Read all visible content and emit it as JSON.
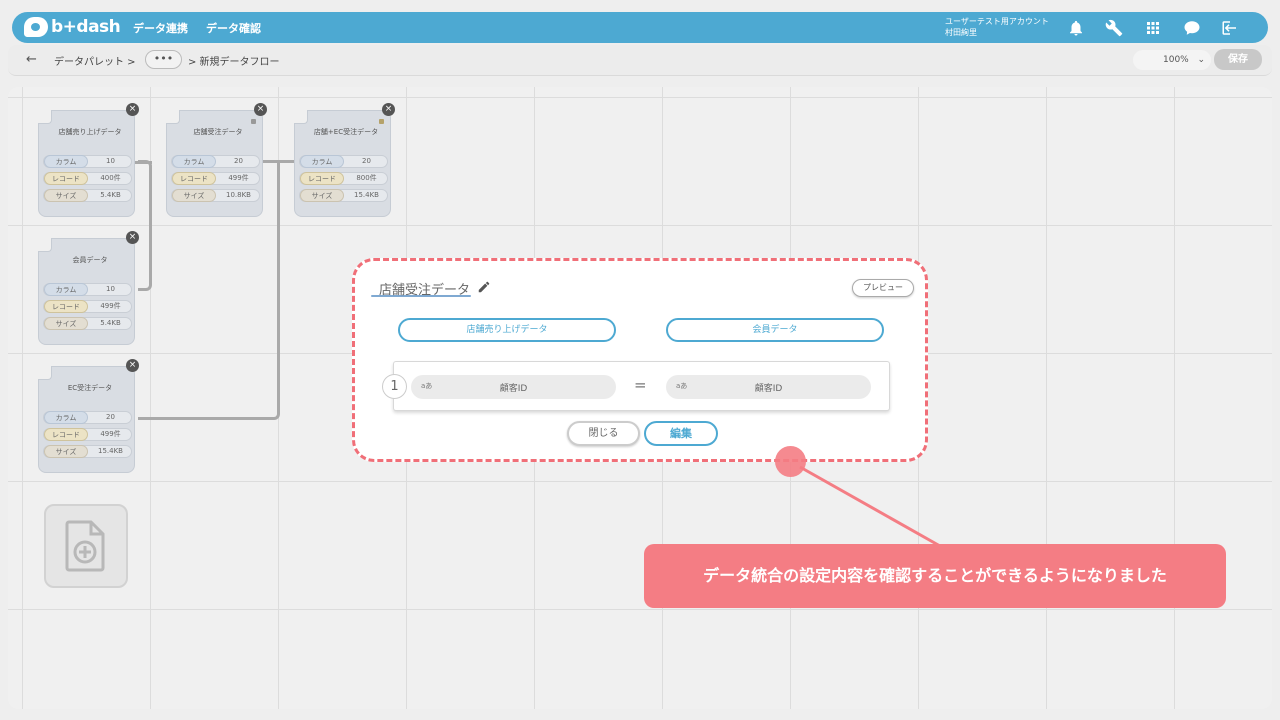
{
  "header": {
    "logo_text": "b+dash",
    "nav": [
      "データ連携",
      "データ確認"
    ],
    "account_line1": "ユーザーテスト用アカウント",
    "account_line2": "村田絢里"
  },
  "breadcrumb": {
    "back_icon": "←",
    "root": "データパレット >",
    "more": "•••",
    "current": "> 新規データフロー",
    "zoom": "100%",
    "save_label": "保存"
  },
  "cards": [
    {
      "title": "店舗売り上げデータ",
      "col_label": "カラム",
      "col": "10",
      "rec_label": "レコード",
      "rec": "400件",
      "size_label": "サイズ",
      "size": "5.4KB"
    },
    {
      "title": "店舗受注データ",
      "col_label": "カラム",
      "col": "20",
      "rec_label": "レコード",
      "rec": "499件",
      "size_label": "サイズ",
      "size": "10.8KB"
    },
    {
      "title": "店舗+EC受注データ",
      "col_label": "カラム",
      "col": "20",
      "rec_label": "レコード",
      "rec": "800件",
      "size_label": "サイズ",
      "size": "15.4KB"
    },
    {
      "title": "会員データ",
      "col_label": "カラム",
      "col": "10",
      "rec_label": "レコード",
      "rec": "499件",
      "size_label": "サイズ",
      "size": "5.4KB"
    },
    {
      "title": "EC受注データ",
      "col_label": "カラム",
      "col": "20",
      "rec_label": "レコード",
      "rec": "499件",
      "size_label": "サイズ",
      "size": "15.4KB"
    }
  ],
  "dialog": {
    "title": "店舗受注データ",
    "preview_label": "プレビュー",
    "left_source": "店舗売り上げデータ",
    "right_source": "会員データ",
    "condition": {
      "index": "1",
      "left_type": "aあ",
      "left_field": "顧客ID",
      "operator": "=",
      "right_type": "aあ",
      "right_field": "顧客ID"
    },
    "close_label": "閉じる",
    "edit_label": "編集"
  },
  "callout": {
    "text": "データ統合の設定内容を確認することができるようになりました"
  }
}
